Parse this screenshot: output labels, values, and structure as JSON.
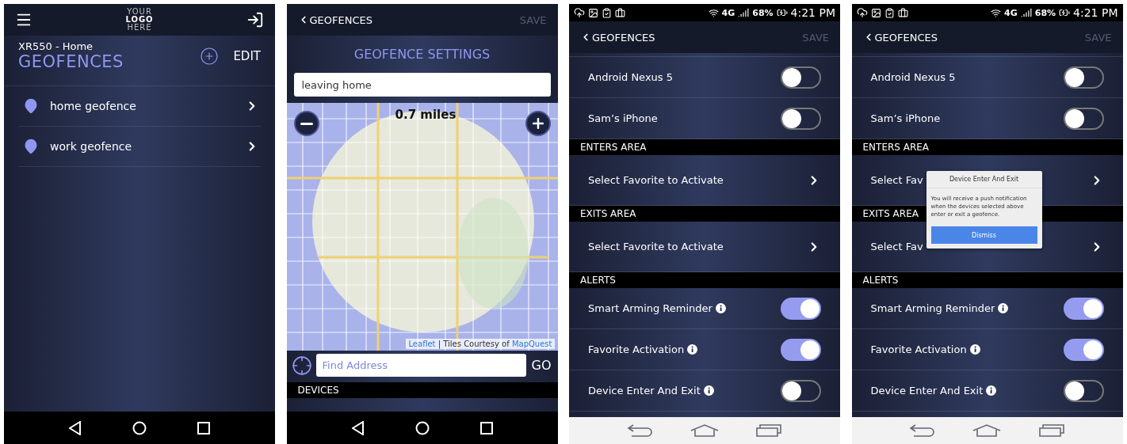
{
  "screens": [
    {
      "kind": "geofence_list",
      "logo": [
        "YOUR",
        "LOGO",
        "HERE"
      ],
      "subtitle": "XR550 - Home",
      "title": "GEOFENCES",
      "edit": "EDIT",
      "items": [
        {
          "label": "home geofence"
        },
        {
          "label": "work geofence"
        }
      ],
      "nav": {
        "kind": "dark"
      }
    },
    {
      "kind": "geofence_map",
      "back": "GEOFENCES",
      "save": "SAVE",
      "save_disabled": true,
      "title": "GEOFENCE SETTINGS",
      "name_value": "leaving home",
      "distance": "0.7 miles",
      "attribution": {
        "link": "Leaflet",
        "text": " | Tiles Courtesy of ",
        "provider": "MapQuest"
      },
      "search": {
        "placeholder": "Find Address",
        "button": "GO"
      },
      "section": "DEVICES",
      "nav": {
        "kind": "dark"
      }
    },
    {
      "kind": "geofence_settings",
      "status_bar": {
        "network": "4G",
        "battery": "68%",
        "time": "4:21 PM"
      },
      "back": "GEOFENCES",
      "save": "SAVE",
      "save_disabled": true,
      "rows": [
        {
          "kind": "toggle",
          "label": "Android Nexus 5",
          "info": false,
          "on": false
        },
        {
          "kind": "toggle",
          "label": "Sam’s iPhone",
          "info": false,
          "on": false
        },
        {
          "kind": "section",
          "label": "ENTERS AREA"
        },
        {
          "kind": "link",
          "label": "Select Favorite to Activate"
        },
        {
          "kind": "section",
          "label": "EXITS AREA"
        },
        {
          "kind": "link",
          "label": "Select Favorite to Activate"
        },
        {
          "kind": "section",
          "label": "ALERTS"
        },
        {
          "kind": "toggle",
          "label": "Smart Arming Reminder",
          "info": true,
          "on": true
        },
        {
          "kind": "toggle",
          "label": "Favorite Activation",
          "info": true,
          "on": true
        },
        {
          "kind": "toggle",
          "label": "Device Enter And Exit",
          "info": true,
          "on": false
        }
      ],
      "nav": {
        "kind": "light"
      }
    },
    {
      "kind": "geofence_settings",
      "status_bar": {
        "network": "4G",
        "battery": "68%",
        "time": "4:21 PM"
      },
      "back": "GEOFENCES",
      "save": "SAVE",
      "save_disabled": true,
      "rows": [
        {
          "kind": "toggle",
          "label": "Android Nexus 5",
          "info": false,
          "on": false
        },
        {
          "kind": "toggle",
          "label": "Sam’s iPhone",
          "info": false,
          "on": false
        },
        {
          "kind": "section",
          "label": "ENTERS AREA"
        },
        {
          "kind": "link",
          "label": "Select Fav"
        },
        {
          "kind": "section",
          "label": "EXITS AREA"
        },
        {
          "kind": "link",
          "label": "Select Fav"
        },
        {
          "kind": "section",
          "label": "ALERTS"
        },
        {
          "kind": "toggle",
          "label": "Smart Arming Reminder",
          "info": true,
          "on": true
        },
        {
          "kind": "toggle",
          "label": "Favorite Activation",
          "info": true,
          "on": true
        },
        {
          "kind": "toggle",
          "label": "Device Enter And Exit",
          "info": true,
          "on": false
        }
      ],
      "nav": {
        "kind": "light"
      },
      "dialog": {
        "title": "Device Enter And Exit",
        "body": "You will receive a push notification when the devices selected above enter or exit a geofence.",
        "button": "Dismiss"
      }
    }
  ]
}
